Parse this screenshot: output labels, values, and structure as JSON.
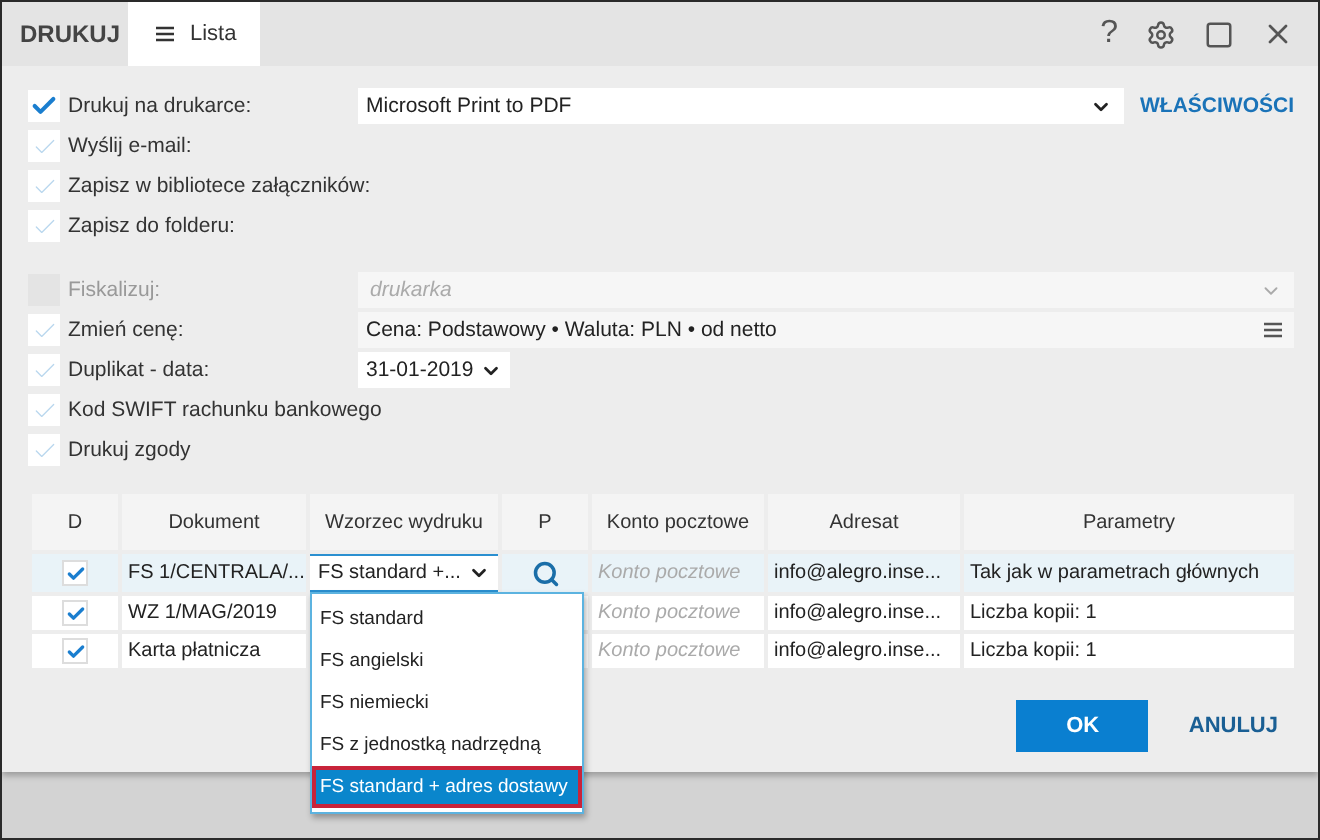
{
  "window": {
    "title": "DRUKUJ",
    "tab": "Lista",
    "help_button": "?"
  },
  "options": [
    {
      "label": "Drukuj na drukarce:",
      "checked": true,
      "disabled": false,
      "control": {
        "kind": "select",
        "value": "Microsoft Print to PDF",
        "link": "WŁAŚCIWOŚCI"
      }
    },
    {
      "label": "Wyślij e-mail:",
      "checked": false,
      "disabled": false
    },
    {
      "label": "Zapisz w bibliotece załączników:",
      "checked": false,
      "disabled": false
    },
    {
      "label": "Zapisz do folderu:",
      "checked": false,
      "disabled": false,
      "gap_after": true
    },
    {
      "label": "Fiskalizuj:",
      "checked": false,
      "disabled": true,
      "control": {
        "kind": "select-disabled",
        "placeholder": "drukarka"
      }
    },
    {
      "label": "Zmień cenę:",
      "checked": false,
      "disabled": false,
      "control": {
        "kind": "menu-field",
        "value": "Cena: Podstawowy • Waluta: PLN • od netto"
      }
    },
    {
      "label": "Duplikat - data:",
      "checked": false,
      "disabled": false,
      "control": {
        "kind": "date",
        "value": "31-01-2019"
      }
    },
    {
      "label": "Kod SWIFT rachunku bankowego",
      "checked": false,
      "disabled": false
    },
    {
      "label": "Drukuj zgody",
      "checked": false,
      "disabled": false
    }
  ],
  "table": {
    "columns": [
      "D",
      "Dokument",
      "Wzorzec wydruku",
      "P",
      "Konto pocztowe",
      "Adresat",
      "Parametry"
    ],
    "rows": [
      {
        "selected": true,
        "checked": true,
        "document": "FS 1/CENTRALA/...",
        "template": "FS standard +...",
        "account_placeholder": "Konto pocztowe",
        "recipient": "info@alegro.inse...",
        "parameters": "Tak jak w parametrach głównych"
      },
      {
        "selected": false,
        "checked": true,
        "document": "WZ 1/MAG/2019",
        "account_placeholder": "Konto pocztowe",
        "recipient": "info@alegro.inse...",
        "parameters": "Liczba kopii: 1"
      },
      {
        "selected": false,
        "checked": true,
        "document": "Karta płatnicza",
        "account_placeholder": "Konto pocztowe",
        "recipient": "info@alegro.inse...",
        "parameters": "Liczba kopii: 1"
      }
    ]
  },
  "dropdown": {
    "items": [
      {
        "label": "FS standard",
        "selected": false
      },
      {
        "label": "FS angielski",
        "selected": false
      },
      {
        "label": "FS niemiecki",
        "selected": false
      },
      {
        "label": "FS z jednostką nadrzędną",
        "selected": false
      },
      {
        "label": "FS standard + adres dostawy",
        "selected": true
      }
    ]
  },
  "buttons": {
    "ok": "OK",
    "cancel": "ANULUJ"
  }
}
